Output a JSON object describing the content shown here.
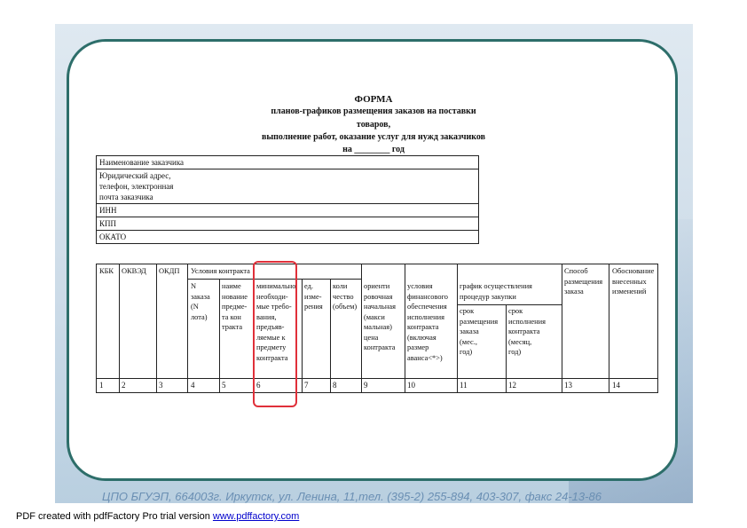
{
  "document": {
    "title": "ФОРМА",
    "subtitle_line1": "планов-графиков размещения заказов на поставки товаров,",
    "subtitle_line2": "выполнение работ, оказание услуг для нужд заказчиков",
    "subtitle_line3": "на ________ год"
  },
  "info_table": {
    "rows": [
      "Наименование заказчика",
      "Юридический адрес,\nтелефон, электронная\nпочта заказчика",
      "ИНН",
      "КПП",
      "ОКАТО"
    ]
  },
  "main_table": {
    "headers": {
      "kbk": "КБК",
      "okved": "ОКВЭД",
      "okdp": "ОКДП",
      "contract_terms": "Условия контракта",
      "lot_no": "N\nзаказа\n(N\nлота)",
      "subject_name": "наиме\nнование\nпредме-\nта кон\nтракта",
      "min_requirements": "минимально\nнеобходи-\nмые требо-\nвания,\nпредъяв-\nляемые к\nпредмету\nконтракта",
      "unit": "ед.\nизме-\nрения",
      "quantity": "коли\nчество\n(объем)",
      "initial_price": "ориенти\nровочная\nначальная\n(макси\nмальная)\nцена\nконтракта",
      "security_terms": "условия\nфинансового\nобеспечения\nисполнения\nконтракта\n(включая\nразмер\nаванса<*>)",
      "schedule": "график осуществления\nпроцедур закупки",
      "placement_deadline": "срок\nразмещения\nзаказа\n(мес.,\nгод)",
      "execution_deadline": "срок\nисполнения\nконтракта\n(месяц,\nгод)",
      "placement_method": "Способ\nразмещения\nзаказа",
      "change_reason": "Обоснование\nвнесенных\nизменений"
    },
    "column_numbers": [
      "1",
      "2",
      "3",
      "4",
      "5",
      "6",
      "7",
      "8",
      "9",
      "10",
      "11",
      "12",
      "13",
      "14"
    ]
  },
  "footer": {
    "text": "ЦПО БГУЭП, 664003г. Иркутск, ул. Ленина, 11,тел. (395-2) 255-894, 403-307, факс 24-13-86"
  },
  "pdf_note": {
    "prefix": "PDF created with pdfFactory Pro trial version ",
    "link": "www.pdffactory.com"
  },
  "colors": {
    "frame_border": "#2d6e6a",
    "highlight_box": "#e0303a",
    "footer_text": "#6a8fb3"
  }
}
